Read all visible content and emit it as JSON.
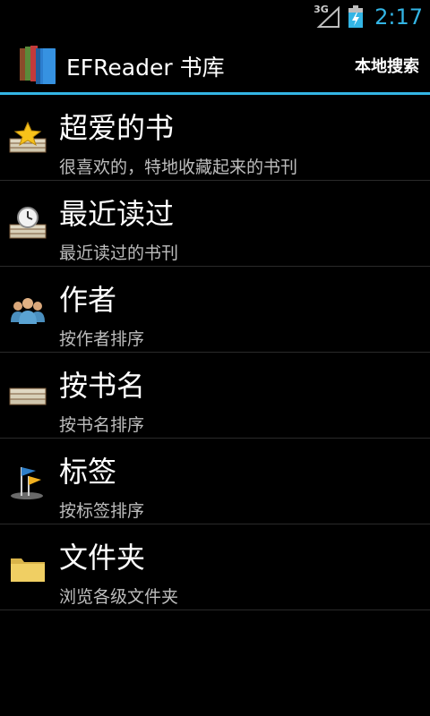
{
  "status": {
    "network": "3G",
    "time": "2:17"
  },
  "actionbar": {
    "title": "EFReader 书库",
    "action_label": "本地搜索"
  },
  "items": [
    {
      "title": "超爱的书",
      "subtitle": "很喜欢的，特地收藏起来的书刊",
      "icon": "star-books-icon"
    },
    {
      "title": "最近读过",
      "subtitle": "最近读过的书刊",
      "icon": "clock-books-icon"
    },
    {
      "title": "作者",
      "subtitle": "按作者排序",
      "icon": "people-icon"
    },
    {
      "title": "按书名",
      "subtitle": "按书名排序",
      "icon": "book-stack-icon"
    },
    {
      "title": "标签",
      "subtitle": "按标签排序",
      "icon": "flag-icon"
    },
    {
      "title": "文件夹",
      "subtitle": "浏览各级文件夹",
      "icon": "folder-icon"
    }
  ],
  "colors": {
    "accent": "#33b5e5",
    "background": "#000000"
  }
}
